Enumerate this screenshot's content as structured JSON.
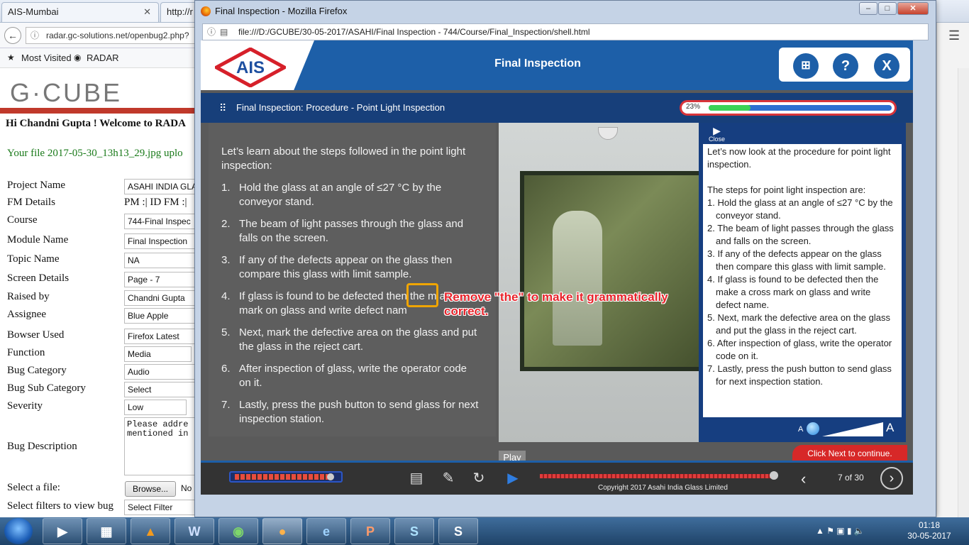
{
  "bg_browser": {
    "tabs": [
      "AIS-Mumbai",
      "http://r"
    ],
    "url": "radar.gc-solutions.net/openbug2.php?",
    "bookmarks": [
      "Most Visited",
      "RADAR"
    ],
    "logo": "G·CUBE",
    "welcome": "Hi Chandni Gupta ! Welcome to RADA",
    "upload_msg": "Your file 2017-05-30_13h13_29.jpg uplo",
    "fields": [
      {
        "label": "Project Name",
        "value": "ASAHI INDIA GLA"
      },
      {
        "label": "FM Details",
        "value": "PM :| ID FM :|"
      },
      {
        "label": "Course",
        "value": "744-Final Inspec"
      },
      {
        "label": "Module Name",
        "value": "Final Inspection"
      },
      {
        "label": "Topic Name",
        "value": "NA"
      },
      {
        "label": "Screen Details",
        "value": "Page - 7"
      },
      {
        "label": "Raised by",
        "value": "Chandni Gupta"
      },
      {
        "label": "Assignee",
        "value": "Blue Apple"
      },
      {
        "label": "Bowser Used",
        "value": "Firefox Latest"
      },
      {
        "label": "Function",
        "value": "Media"
      },
      {
        "label": "Bug Category",
        "value": "Audio"
      },
      {
        "label": "Bug Sub Category",
        "value": "Select"
      },
      {
        "label": "Severity",
        "value": "Low"
      }
    ],
    "bug_description_label": "Bug Description",
    "bug_description_value": "Please addre mentioned in",
    "select_file_label": "Select a file:",
    "browse_button": "Browse...",
    "no_file": "No",
    "filters_label": "Select filters to view bug",
    "filters_value": "Select Filter"
  },
  "window": {
    "title": "Final Inspection - Mozilla Firefox",
    "url": "file:///D:/GCUBE/30-05-2017/ASAHI/Final Inspection - 744/Course/Final_Inspection/shell.html"
  },
  "course": {
    "logo": "AIS",
    "title": "Final Inspection",
    "header_buttons": {
      "sitemap_icon": "sitemap-icon",
      "help": "?",
      "close": "X"
    },
    "subtitle": "Final Inspection: Procedure - Point Light Inspection",
    "progress_label": "23%",
    "progress": 0.23,
    "intro": "Let’s learn about the steps followed in the point light inspection:",
    "steps": [
      "Hold the glass at an angle of ≤27 °C by the conveyor stand.",
      "The beam of light passes through the glass and falls on the screen.",
      "If any of the defects appear on the glass then compare this glass with limit sample.",
      "If glass is found to be defected then the m a cross mark on glass and write defect nam",
      "Next, mark the defective area on the glass and put the glass in the reject cart.",
      "After inspection of glass, write the operator code on it.",
      "Lastly, press the push button to send glass for next inspection station."
    ],
    "notes_close": "Close",
    "notes_intro": "Let’s now look at the procedure for point light inspection.",
    "notes_steps_heading": "The steps for point light inspection are:",
    "notes_steps": [
      "1. Hold the glass at an angle of ≤27 °C by the conveyor stand.",
      "2. The beam of light passes through the glass and falls on the screen.",
      "3. If any of the defects appear on the glass then compare this glass with limit sample.",
      "4. If glass is found to be defected then the make a cross mark on glass and write defect name.",
      "5. Next, mark the defective area on the glass and put the glass in the reject cart.",
      "6. After inspection of glass, write the operator code on it.",
      "7. Lastly, press the push button to send glass for next inspection station."
    ],
    "font_small": "A",
    "font_large": "A",
    "click_next": "Click Next to continue.",
    "play_tooltip": "Play",
    "copyright": "Copyright 2017 Asahi India Glass Limited",
    "page_counter": "7 of 30"
  },
  "annotation": {
    "text": "Remove \"the\" to make it grammatically correct.",
    "color": "#e8232b",
    "highlight_color": "#f0a500"
  },
  "taskbar": {
    "time": "01:18",
    "date": "30-05-2017"
  }
}
